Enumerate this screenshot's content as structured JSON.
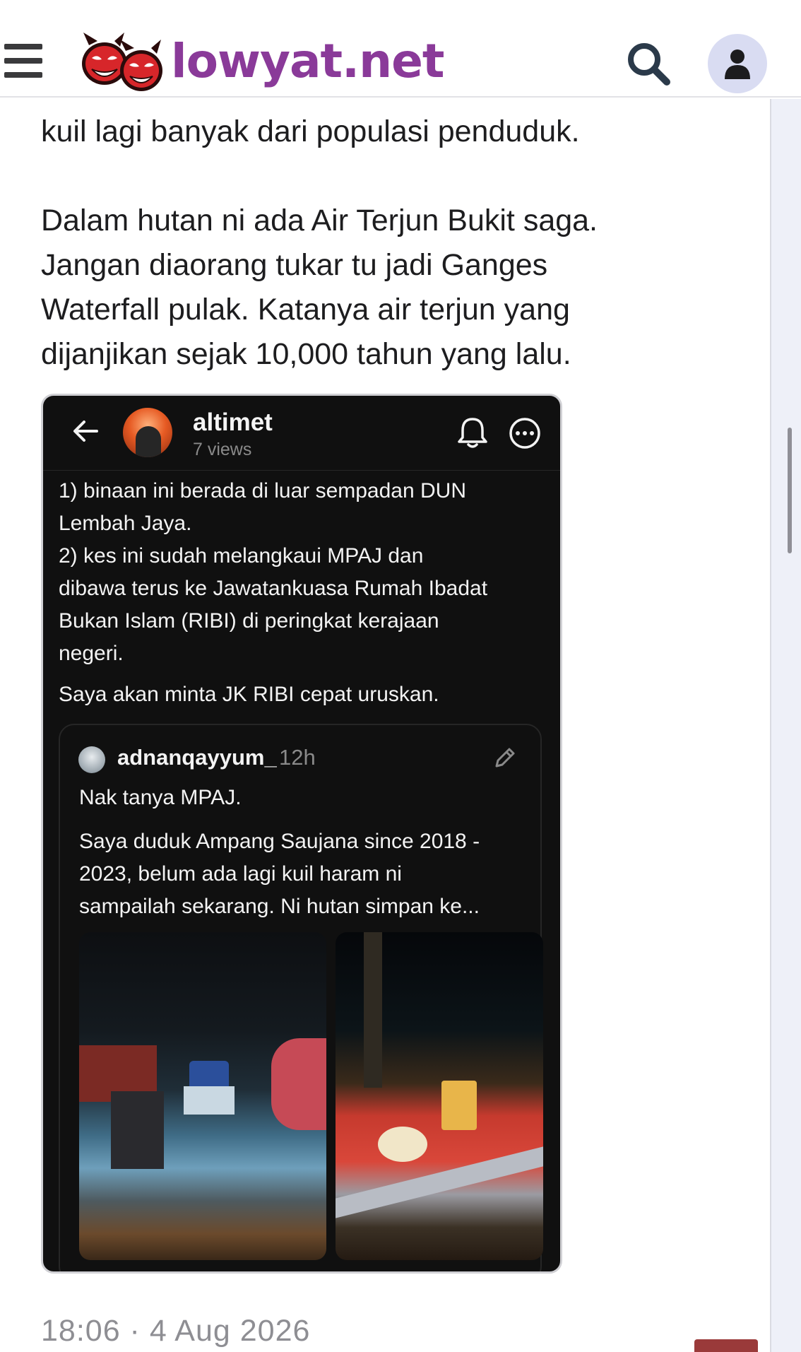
{
  "header": {
    "logo_text": "lowyat.net",
    "icons": {
      "menu": "hamburger-menu-icon",
      "logo": "devil-mascot-logo",
      "search": "search-icon",
      "account": "user-account-icon"
    },
    "colors": {
      "logo_text": "#8a3a99",
      "account_bg": "#d9dcf2"
    }
  },
  "post": {
    "paragraph_1": "kuil lagi banyak dari populasi penduduk.",
    "paragraph_2": "Dalam hutan ni ada Air Terjun Bukit saga.\nJangan diaorang tukar tu jadi Ganges\nWaterfall pulak. Katanya air terjun yang\ndijanjikan sejak 10,000 tahun yang lalu.",
    "timestamp": "18:06 · 4 Aug 2026"
  },
  "embed": {
    "username": "altimet",
    "views": "7 views",
    "icons": {
      "back": "back-arrow-icon",
      "bell": "bell-icon",
      "more": "more-options-icon"
    },
    "text_1": "1) binaan ini berada di luar sempadan DUN\nLembah Jaya.\n2) kes ini sudah melangkaui MPAJ dan\ndibawa terus ke Jawatankuasa Rumah Ibadat\nBukan Islam (RIBI) di peringkat kerajaan\nnegeri.",
    "text_2": "Saya akan minta JK RIBI cepat uruskan.",
    "quoted": {
      "username": "adnanqayyum_",
      "time": "12h",
      "edit_icon": "pencil-icon",
      "text_1": "Nak tanya MPAJ.",
      "text_2": "Saya duduk Ampang Saujana since 2018 -\n2023, belum ada lagi kuil haram ni\nsampailah sekarang. Ni hutan simpan ke..."
    },
    "colors": {
      "background": "#101010",
      "muted": "#8a8a8a"
    }
  }
}
